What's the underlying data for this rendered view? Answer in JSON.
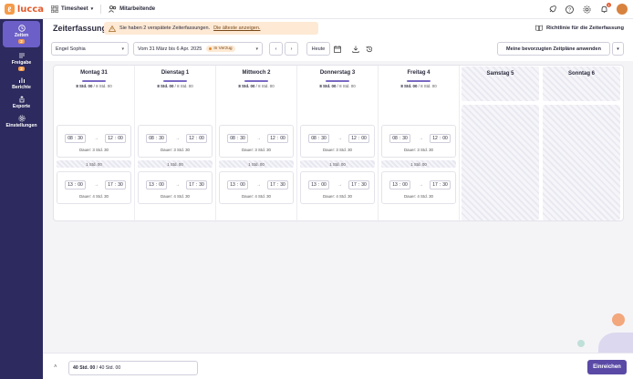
{
  "topbar": {
    "logo_text": "lucca",
    "app_name": "Timesheet",
    "nav_employees": "Mitarbeitende",
    "notification_count": "1"
  },
  "sidebar": {
    "items": [
      {
        "label": "Zeiten",
        "badge": "2",
        "icon": "clock-icon",
        "active": true
      },
      {
        "label": "Freigabe",
        "badge": "2",
        "icon": "checklist-icon",
        "active": false
      },
      {
        "label": "Berichte",
        "badge": "",
        "icon": "chart-icon",
        "active": false
      },
      {
        "label": "Exporte",
        "badge": "",
        "icon": "export-icon",
        "active": false
      },
      {
        "label": "Einstellungen",
        "badge": "",
        "icon": "gear-icon",
        "active": false
      }
    ]
  },
  "page": {
    "title": "Zeiterfassung",
    "alert_text": "Sie haben 2 verspätete Zeiterfassungen.",
    "alert_link": "Die älteste anzeigen.",
    "policy_link": "Richtlinie für die Zeiterfassung"
  },
  "filters": {
    "employee": "Engel Sophia",
    "period": "Vom 31 März bis 6 Apr. 2025",
    "status": "In Verzug",
    "today": "Heute",
    "apply_button": "Meine bevorzugten Zeitpläne anwenden"
  },
  "days": [
    {
      "name": "Montag 31",
      "done": "8 Std. 00",
      "target": "8 Std. 00",
      "morning_start": [
        "08",
        "30"
      ],
      "morning_end": [
        "12",
        "00"
      ],
      "morning_duration": "Dauer: 3 Std. 30",
      "pause": "1 Std. 00",
      "afternoon_start": [
        "13",
        "00"
      ],
      "afternoon_end": [
        "17",
        "30"
      ],
      "afternoon_duration": "Dauer: 4 Std. 30"
    },
    {
      "name": "Dienstag 1",
      "done": "8 Std. 00",
      "target": "8 Std. 00",
      "morning_start": [
        "08",
        "30"
      ],
      "morning_end": [
        "12",
        "00"
      ],
      "morning_duration": "Dauer: 3 Std. 30",
      "pause": "1 Std. 00",
      "afternoon_start": [
        "13",
        "00"
      ],
      "afternoon_end": [
        "17",
        "30"
      ],
      "afternoon_duration": "Dauer: 4 Std. 30"
    },
    {
      "name": "Mittwoch 2",
      "done": "8 Std. 00",
      "target": "8 Std. 00",
      "morning_start": [
        "08",
        "30"
      ],
      "morning_end": [
        "12",
        "00"
      ],
      "morning_duration": "Dauer: 3 Std. 30",
      "pause": "1 Std. 00",
      "afternoon_start": [
        "13",
        "00"
      ],
      "afternoon_end": [
        "17",
        "30"
      ],
      "afternoon_duration": "Dauer: 4 Std. 30"
    },
    {
      "name": "Donnerstag 3",
      "done": "8 Std. 00",
      "target": "8 Std. 00",
      "morning_start": [
        "08",
        "30"
      ],
      "morning_end": [
        "12",
        "00"
      ],
      "morning_duration": "Dauer: 3 Std. 30",
      "pause": "1 Std. 00",
      "afternoon_start": [
        "13",
        "00"
      ],
      "afternoon_end": [
        "17",
        "30"
      ],
      "afternoon_duration": "Dauer: 4 Std. 30"
    },
    {
      "name": "Freitag 4",
      "done": "8 Std. 00",
      "target": "8 Std. 00",
      "morning_start": [
        "08",
        "30"
      ],
      "morning_end": [
        "12",
        "00"
      ],
      "morning_duration": "Dauer: 3 Std. 30",
      "pause": "1 Std. 00",
      "afternoon_start": [
        "13",
        "00"
      ],
      "afternoon_end": [
        "17",
        "30"
      ],
      "afternoon_duration": "Dauer: 4 Std. 30"
    }
  ],
  "weekend": [
    "Samstag 5",
    "Sonntag 6"
  ],
  "footer": {
    "total_done": "40 Std. 00",
    "total_target": "40 Std. 00",
    "submit": "Einreichen"
  },
  "colors": {
    "sidebar": "#2c2a5e",
    "accent": "#6c5fc7",
    "submit": "#5a4aa6",
    "alert_bg": "#fde9d4",
    "badge": "#f59b4a"
  }
}
